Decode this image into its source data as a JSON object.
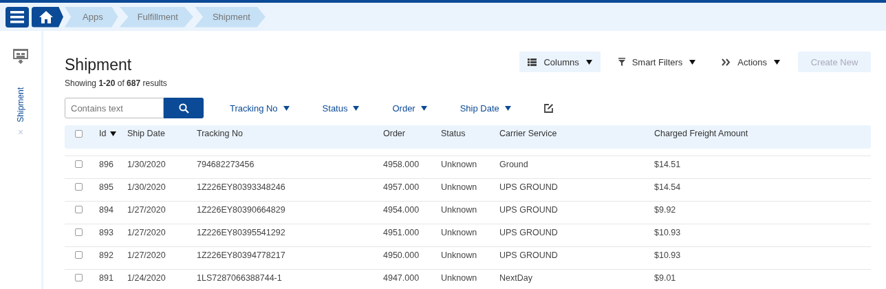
{
  "breadcrumbs": [
    "Apps",
    "Fulfillment",
    "Shipment"
  ],
  "sidebar": {
    "tab": {
      "label": "Shipment",
      "close": "×",
      "selected": true
    }
  },
  "page": {
    "title": "Shipment",
    "summary": "Showing **1-20** of **687** results"
  },
  "toolbar": [
    {
      "label": "Columns",
      "kind": "columns",
      "selected": true
    },
    {
      "label": "Smart Filters",
      "kind": "filters",
      "selected": false
    },
    {
      "label": "Actions",
      "kind": "actions",
      "selected": false
    }
  ],
  "create_button": {
    "label": "Create New",
    "disabled": true
  },
  "search": {
    "placeholder": "Contains text"
  },
  "filters": [
    "Tracking No",
    "Status",
    "Order",
    "Ship Date"
  ],
  "table": {
    "select_all": {
      "checked": false
    },
    "columns": [
      {
        "label": "Id",
        "sorted": true
      },
      {
        "label": "Ship Date",
        "sorted": false
      },
      {
        "label": "Tracking No",
        "sorted": false
      },
      {
        "label": "Order",
        "sorted": false
      },
      {
        "label": "Status",
        "sorted": false
      },
      {
        "label": "Carrier Service",
        "sorted": false
      },
      {
        "label": "Charged Freight Amount",
        "sorted": false
      }
    ],
    "rows": [
      {
        "checked": false,
        "cells": [
          "896",
          "1/30/2020",
          "794682273456",
          "4958.000",
          "Unknown",
          "Ground",
          "$14.51"
        ]
      },
      {
        "checked": false,
        "cells": [
          "895",
          "1/30/2020",
          "1Z226EY80393348246",
          "4957.000",
          "Unknown",
          "UPS GROUND",
          "$14.54"
        ]
      },
      {
        "checked": false,
        "cells": [
          "894",
          "1/27/2020",
          "1Z226EY80390664829",
          "4954.000",
          "Unknown",
          "UPS GROUND",
          "$9.92"
        ]
      },
      {
        "checked": false,
        "cells": [
          "893",
          "1/27/2020",
          "1Z226EY80395541292",
          "4951.000",
          "Unknown",
          "UPS GROUND",
          "$10.93"
        ]
      },
      {
        "checked": false,
        "cells": [
          "892",
          "1/27/2020",
          "1Z226EY80394778217",
          "4950.000",
          "Unknown",
          "UPS GROUND",
          "$10.93"
        ]
      },
      {
        "checked": false,
        "cells": [
          "891",
          "1/24/2020",
          "1LS7287066388744-1",
          "4947.000",
          "Unknown",
          "NextDay",
          "$9.01"
        ]
      }
    ]
  }
}
